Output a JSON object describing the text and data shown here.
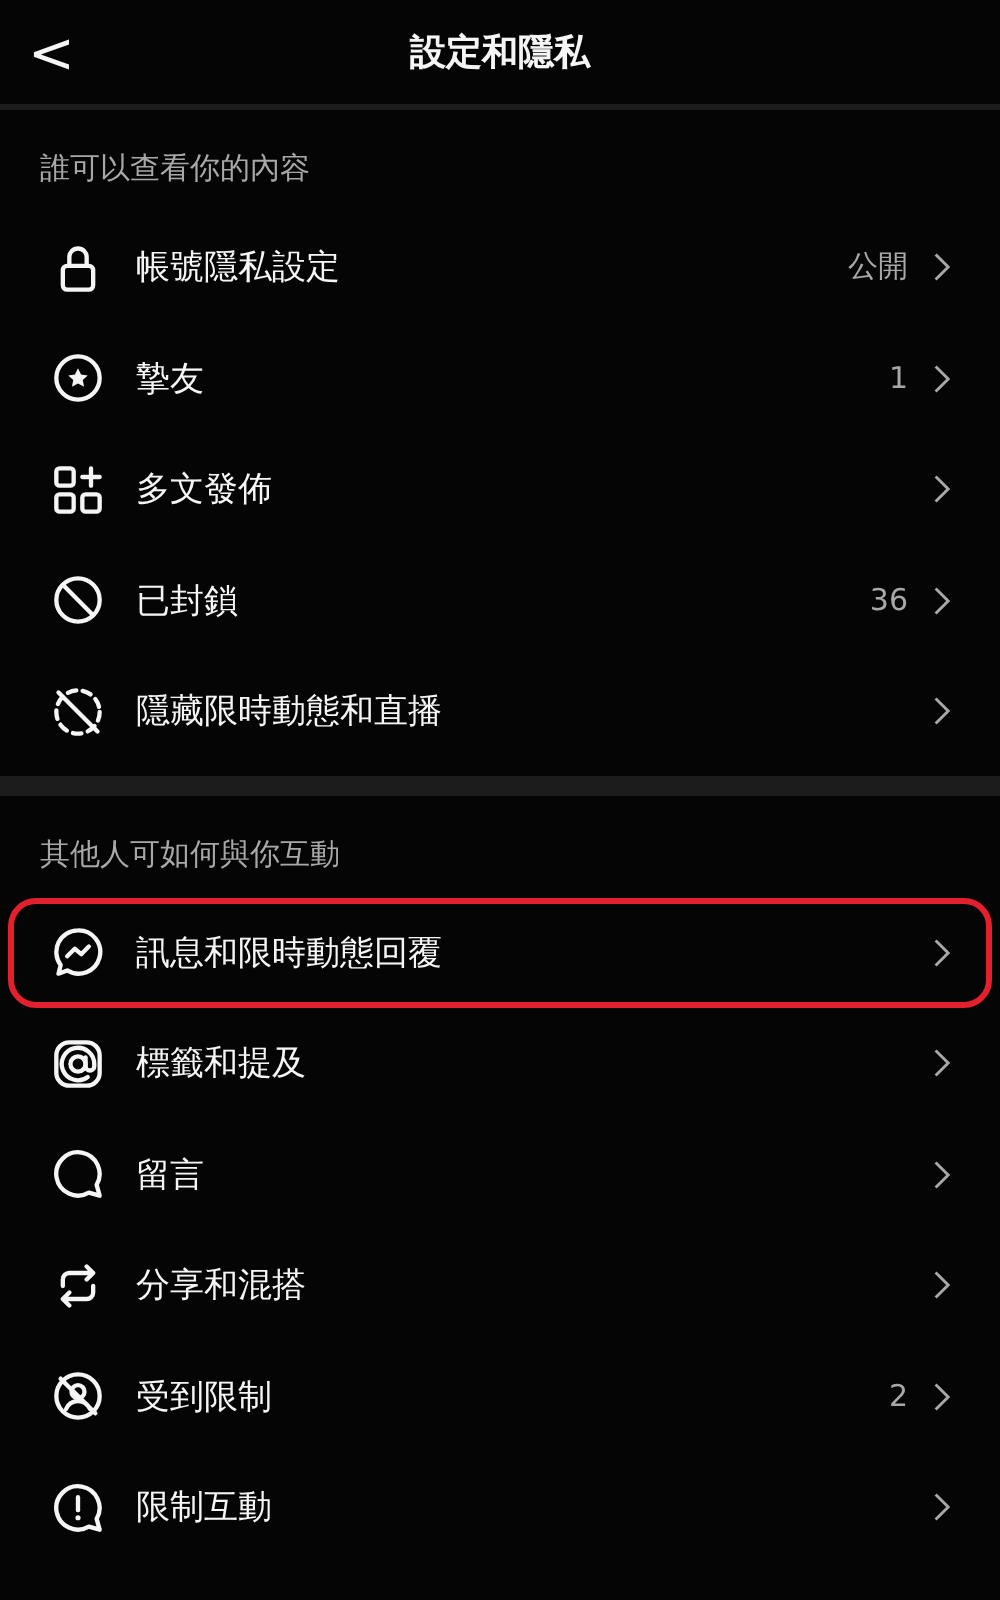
{
  "header": {
    "back": "<",
    "title": "設定和隱私"
  },
  "sections": [
    {
      "heading": "誰可以查看你的內容",
      "items": [
        {
          "label": "帳號隱私設定",
          "value": "公開",
          "highlighted": false
        },
        {
          "label": "摯友",
          "value": "1",
          "highlighted": false
        },
        {
          "label": "多文發佈",
          "highlighted": false
        },
        {
          "label": "已封鎖",
          "value": "36",
          "highlighted": false
        },
        {
          "label": "隱藏限時動態和直播",
          "highlighted": false
        }
      ]
    },
    {
      "heading": "其他人可如何與你互動",
      "items": [
        {
          "label": "訊息和限時動態回覆",
          "highlighted": true
        },
        {
          "label": "標籤和提及",
          "highlighted": false
        },
        {
          "label": "留言",
          "highlighted": false
        },
        {
          "label": "分享和混搭",
          "highlighted": false
        },
        {
          "label": "受到限制",
          "value": "2",
          "highlighted": false
        },
        {
          "label": "限制互動",
          "highlighted": false
        }
      ]
    }
  ]
}
